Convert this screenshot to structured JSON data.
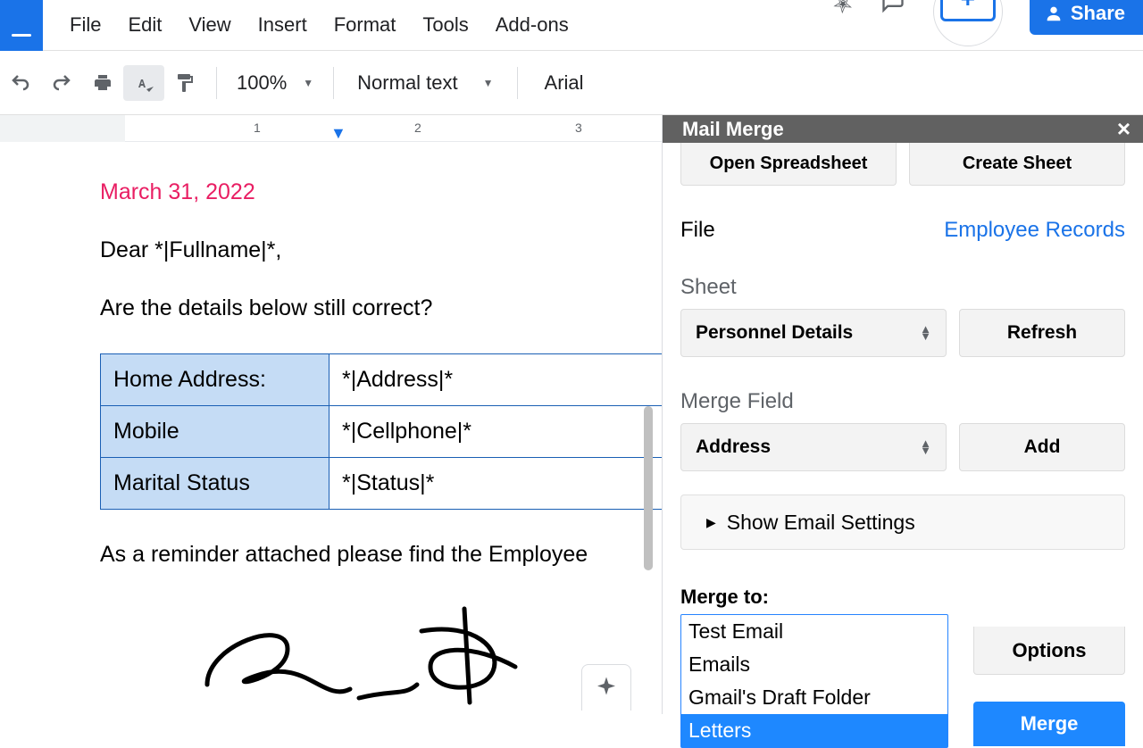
{
  "menus": [
    "File",
    "Edit",
    "View",
    "Insert",
    "Format",
    "Tools",
    "Add-ons"
  ],
  "share_label": "Share",
  "toolbar": {
    "zoom": "100%",
    "style": "Normal text",
    "font": "Arial"
  },
  "ruler": {
    "n1": "1",
    "n2": "2",
    "n3": "3"
  },
  "doc": {
    "date": "March 31, 2022",
    "greeting": "Dear *|Fullname|*,",
    "question": "Are the details below still correct?",
    "rows": [
      {
        "label": "Home Address:",
        "value": "*|Address|*"
      },
      {
        "label": "Mobile",
        "value": "*|Cellphone|*"
      },
      {
        "label": "Marital Status",
        "value": "*|Status|*"
      }
    ],
    "reminder": "As a reminder attached please find the Employee"
  },
  "panel": {
    "title": "Mail Merge",
    "open_btn": "Open Spreadsheet",
    "create_btn": "Create Sheet",
    "file_label": "File",
    "file_link": "Employee Records",
    "sheet_label": "Sheet",
    "sheet_value": "Personnel Details",
    "refresh_btn": "Refresh",
    "field_label": "Merge Field",
    "field_value": "Address",
    "add_btn": "Add",
    "email_settings": "Show Email Settings",
    "merge_to_label": "Merge to:",
    "options": [
      "Test Email",
      "Emails",
      "Gmail's Draft Folder",
      "Letters"
    ],
    "selected_index": 3,
    "options_btn": "Options",
    "merge_btn": "Merge"
  }
}
